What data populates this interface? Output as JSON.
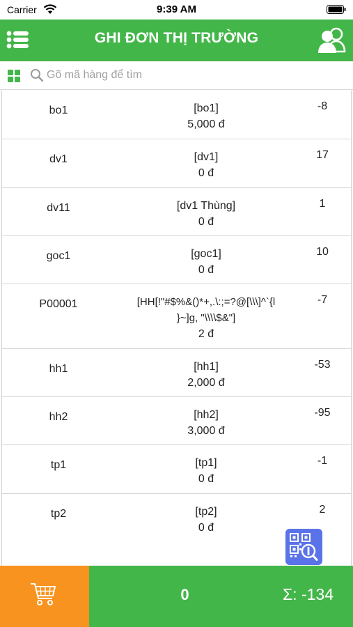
{
  "status_bar": {
    "carrier": "Carrier",
    "time": "9:39 AM"
  },
  "header": {
    "title": "GHI ĐƠN THỊ TRƯỜNG",
    "menu_icon": "menu-list-icon",
    "users_icon": "users-icon"
  },
  "search": {
    "placeholder": "Gõ mã hàng để tìm",
    "value": ""
  },
  "items": [
    {
      "code": "bo1",
      "name": "[bo1]",
      "price": "5,000 đ",
      "qty": "-8"
    },
    {
      "code": "dv1",
      "name": "[dv1]",
      "price": "0 đ",
      "qty": "17"
    },
    {
      "code": "dv11",
      "name": "[dv1 Thùng]",
      "price": "0 đ",
      "qty": "1"
    },
    {
      "code": "goc1",
      "name": "[goc1]",
      "price": "0 đ",
      "qty": "10"
    },
    {
      "code": "P00001",
      "name": "[HH[!\"#$%&()*+,.\\:;=?@[\\\\\\]^`{l",
      "name2": "}~]g, \"\\\\\\\\$&\"]",
      "price": "2 đ",
      "qty": "-7"
    },
    {
      "code": "hh1",
      "name": "[hh1]",
      "price": "2,000 đ",
      "qty": "-53"
    },
    {
      "code": "hh2",
      "name": "[hh2]",
      "price": "3,000 đ",
      "qty": "-95"
    },
    {
      "code": "tp1",
      "name": "[tp1]",
      "price": "0 đ",
      "qty": "-1"
    },
    {
      "code": "tp2",
      "name": "[tp2]",
      "price": "0 đ",
      "qty": "2"
    }
  ],
  "footer": {
    "count": "0",
    "sum": "Σ: -134",
    "cart_icon": "shopping-cart-icon"
  },
  "colors": {
    "primary_green": "#43b649",
    "cart_orange": "#f7931e",
    "qr_blue": "#5b73e8"
  }
}
